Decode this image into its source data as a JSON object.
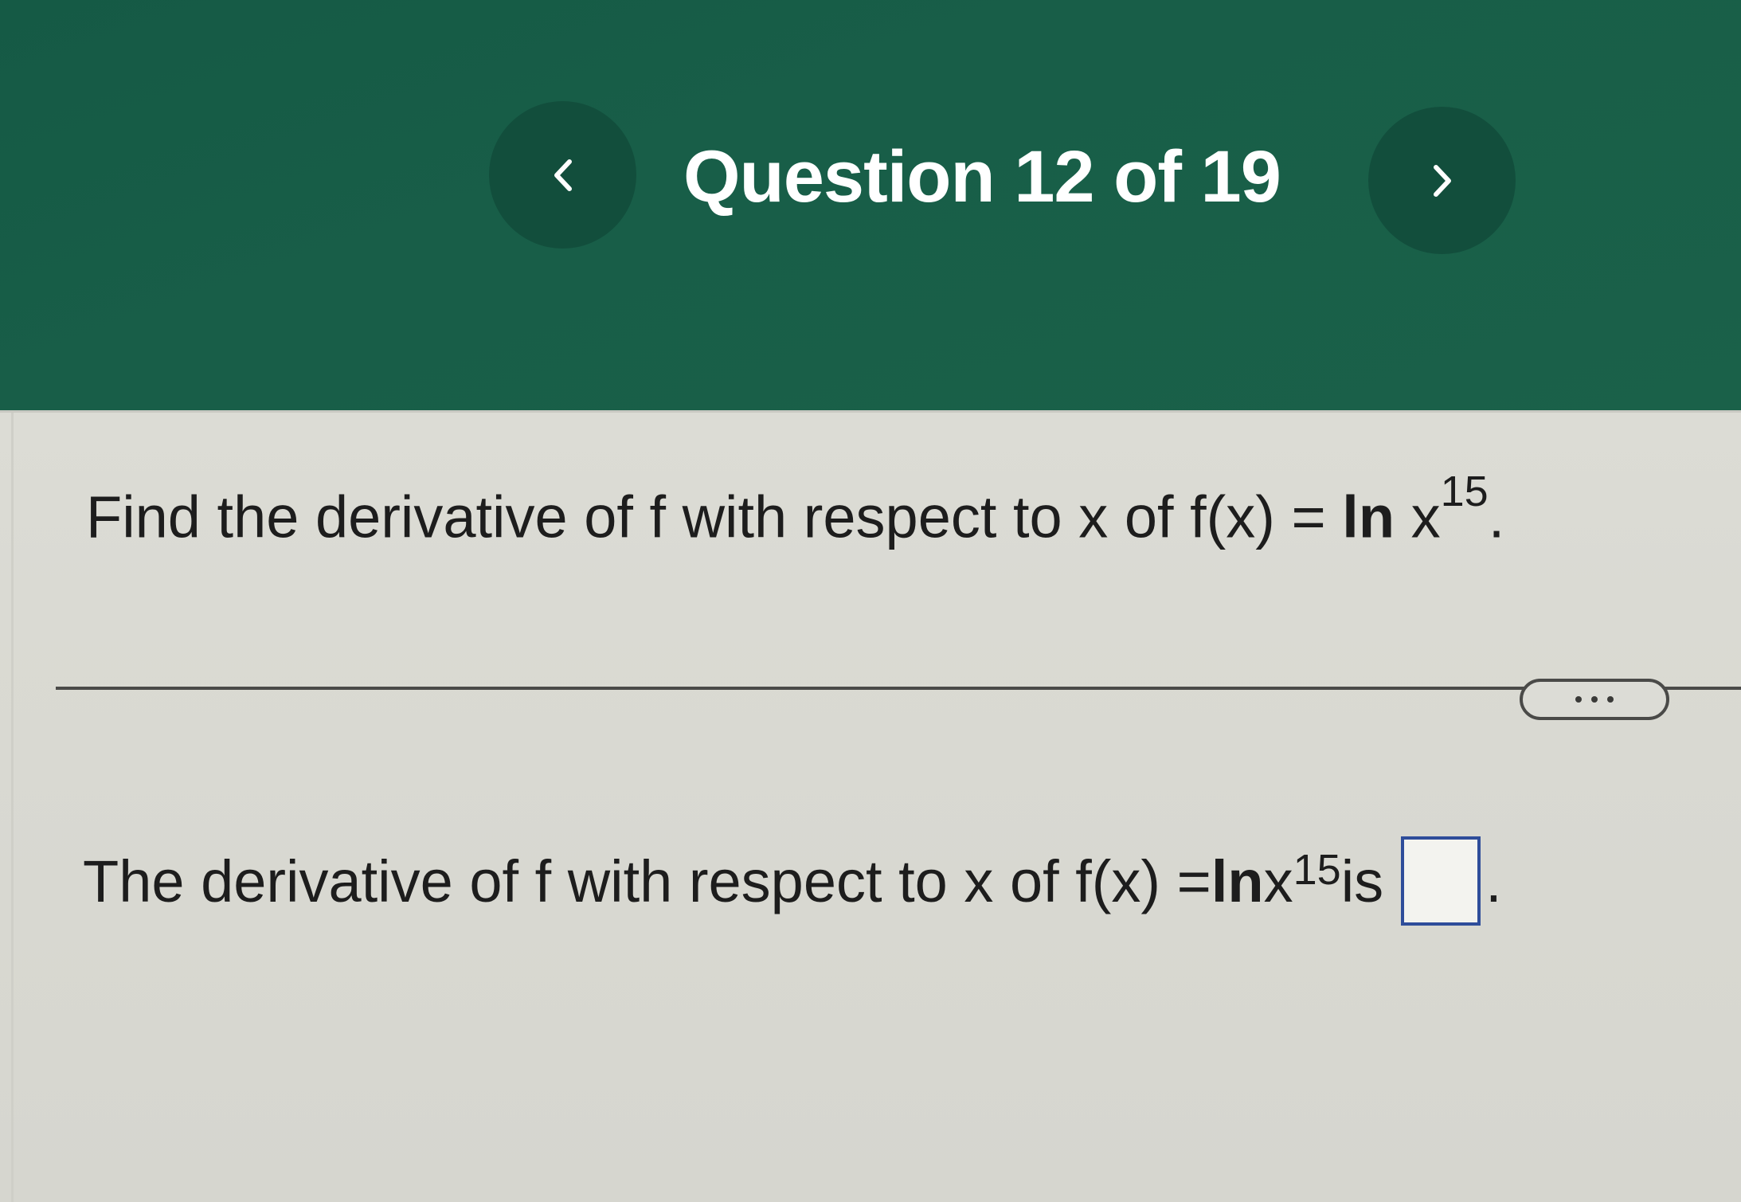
{
  "header": {
    "title": "Question 12 of 19",
    "prev_icon": "chevron-left-icon",
    "next_icon": "chevron-right-icon"
  },
  "question": {
    "prefix": "Find the derivative of f with respect to x of f(x) = ",
    "fn": "ln",
    "var": " x",
    "exponent": "15",
    "suffix": "."
  },
  "more_button": {
    "icon": "ellipsis-icon"
  },
  "answer": {
    "prefix": "The derivative of f with respect to x of f(x) = ",
    "fn": "ln",
    "var": " x",
    "exponent": "15",
    "mid": " is",
    "value": "",
    "suffix": "."
  },
  "colors": {
    "header_green": "#185e48",
    "nav_button": "#124e3c",
    "answer_box_border": "#2e4d9a"
  }
}
